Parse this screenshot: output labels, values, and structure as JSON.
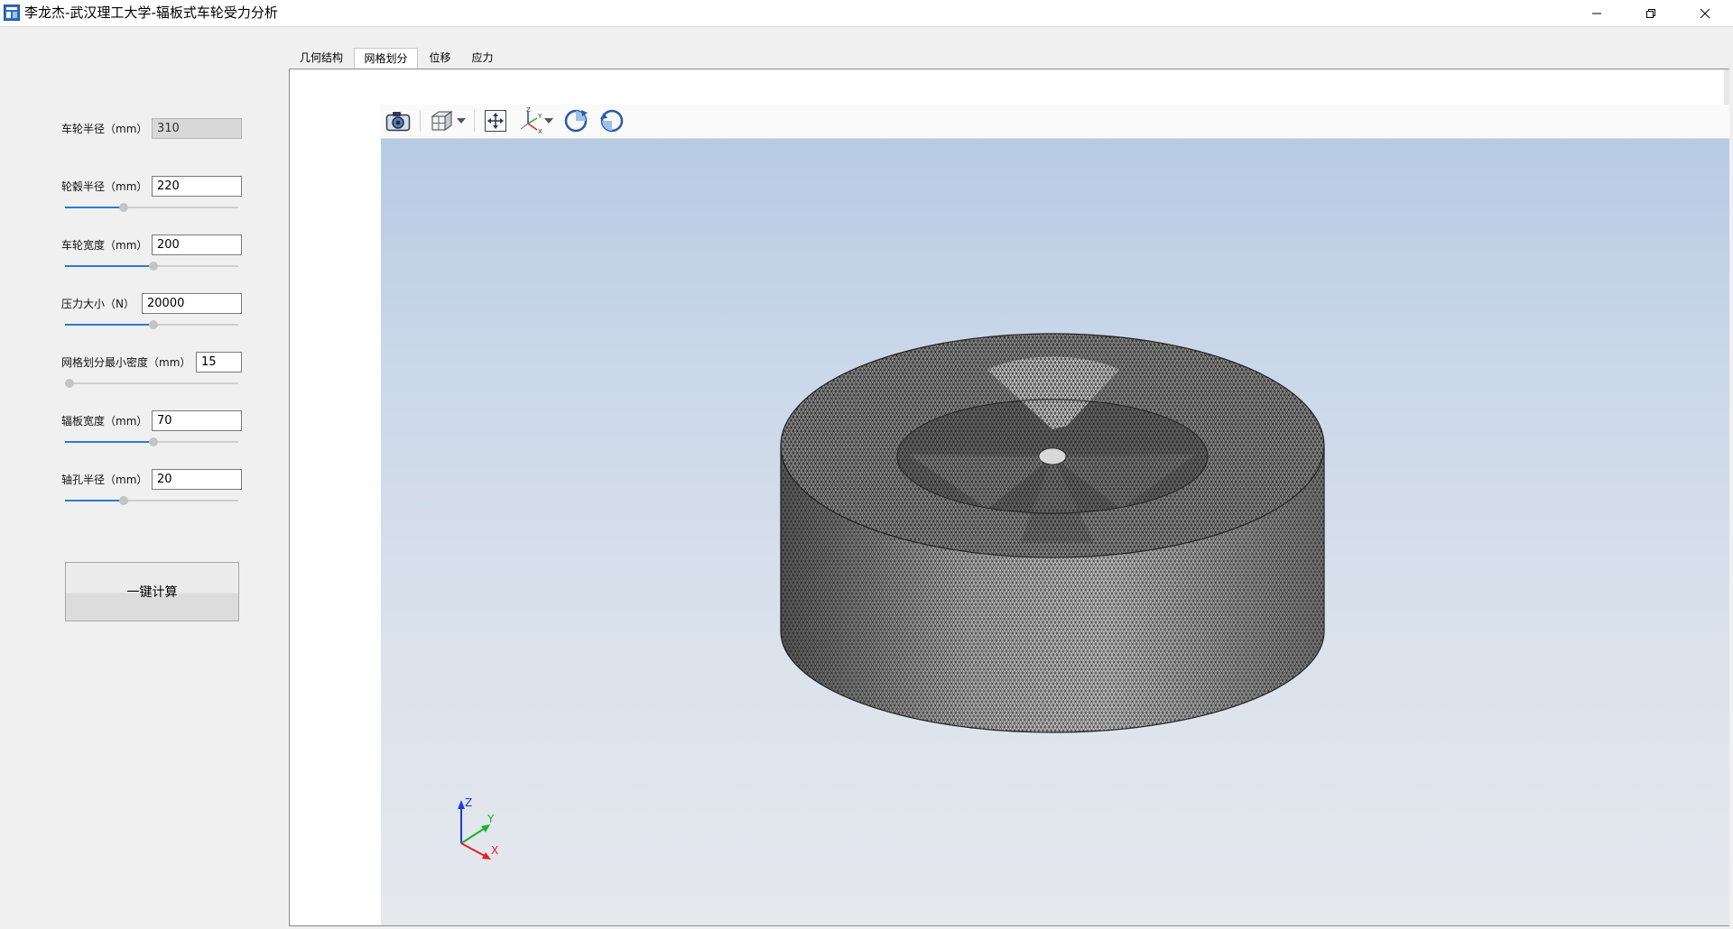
{
  "window": {
    "title": "李龙杰-武汉理工大学-辐板式车轮受力分析",
    "minimize_icon": "minimize-icon",
    "maximize_icon": "restore-icon",
    "close_icon": "close-icon"
  },
  "params": [
    {
      "label": "车轮半径（mm）",
      "value": "310",
      "disabled": true
    },
    {
      "label": "轮毂半径（mm）",
      "value": "220",
      "slider_fraction": 0.34
    },
    {
      "label": "车轮宽度（mm）",
      "value": "200",
      "slider_fraction": 0.51
    },
    {
      "label": "压力大小（N）",
      "value": "20000",
      "slider_fraction": 0.51
    },
    {
      "label": "网格划分最小密度（mm）",
      "value": "15",
      "slider_fraction": 0.0
    },
    {
      "label": "辐板宽度（mm）",
      "value": "70",
      "slider_fraction": 0.51
    },
    {
      "label": "轴孔半径（mm）",
      "value": "20",
      "slider_fraction": 0.34
    }
  ],
  "compute_button": {
    "label": "一键计算"
  },
  "tabs": [
    {
      "label": "几何结构",
      "active": false
    },
    {
      "label": "网格划分",
      "active": true
    },
    {
      "label": "位移",
      "active": false
    },
    {
      "label": "应力",
      "active": false
    }
  ],
  "viewer": {
    "toolbar_icons": [
      "camera-icon",
      "cube-view-icon",
      "fit-view-icon",
      "axes-view-icon",
      "rotate-ccw-icon",
      "rotate-cw-icon"
    ],
    "axes_triad": {
      "x": "X",
      "y": "Y",
      "z": "Z"
    },
    "colors": {
      "x_axis": "#e02020",
      "y_axis": "#22b022",
      "z_axis": "#1e3cd8",
      "mesh_fill": "#a8a8a8",
      "mesh_line": "#1a1a1a"
    }
  }
}
